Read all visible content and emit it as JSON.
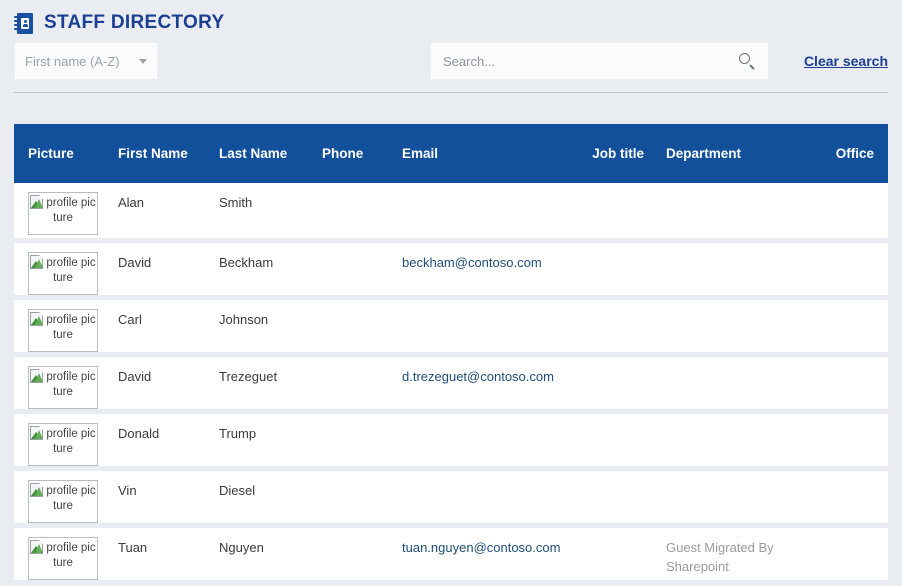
{
  "header": {
    "title": "STAFF DIRECTORY",
    "icon": "address-book-icon"
  },
  "toolbar": {
    "sort": {
      "selected": "First name (A-Z)",
      "icon": "chevron-down-icon"
    },
    "search": {
      "value": "",
      "placeholder": "Search...",
      "icon": "search-icon"
    },
    "clear_search_label": "Clear search"
  },
  "table": {
    "columns": [
      {
        "key": "picture",
        "label": "Picture",
        "align": "left"
      },
      {
        "key": "first_name",
        "label": "First Name",
        "align": "left"
      },
      {
        "key": "last_name",
        "label": "Last Name",
        "align": "left"
      },
      {
        "key": "phone",
        "label": "Phone",
        "align": "left"
      },
      {
        "key": "email",
        "label": "Email",
        "align": "left"
      },
      {
        "key": "job_title",
        "label": "Job title",
        "align": "right"
      },
      {
        "key": "department",
        "label": "Department",
        "align": "left"
      },
      {
        "key": "office",
        "label": "Office",
        "align": "right"
      }
    ],
    "picture_alt": "profile picture",
    "rows": [
      {
        "picture_alt": "profile picture",
        "first_name": "Alan",
        "last_name": "Smith",
        "phone": "",
        "email": "",
        "job_title": "",
        "department": "",
        "office": ""
      },
      {
        "picture_alt": "profile picture",
        "first_name": "David",
        "last_name": "Beckham",
        "phone": "",
        "email": "beckham@contoso.com",
        "job_title": "",
        "department": "",
        "office": ""
      },
      {
        "picture_alt": "profile picture",
        "first_name": "Carl",
        "last_name": "Johnson",
        "phone": "",
        "email": "",
        "job_title": "",
        "department": "",
        "office": ""
      },
      {
        "picture_alt": "profile picture",
        "first_name": "David",
        "last_name": "Trezeguet",
        "phone": "",
        "email": "d.trezeguet@contoso.com",
        "job_title": "",
        "department": "",
        "office": ""
      },
      {
        "picture_alt": "profile picture",
        "first_name": "Donald",
        "last_name": "Trump",
        "phone": "",
        "email": "",
        "job_title": "",
        "department": "",
        "office": ""
      },
      {
        "picture_alt": "profile picture",
        "first_name": "Vin",
        "last_name": "Diesel",
        "phone": "",
        "email": "",
        "job_title": "",
        "department": "",
        "office": ""
      },
      {
        "picture_alt": "profile picture",
        "first_name": "Tuan",
        "last_name": "Nguyen",
        "phone": "",
        "email": "tuan.nguyen@contoso.com",
        "job_title": "",
        "department": "Guest Migrated By Sharepoint",
        "office": ""
      }
    ]
  },
  "colors": {
    "page_background": "#e9edf1",
    "table_header": "#12509c",
    "title": "#1c3f94",
    "link": "#1f4e79",
    "muted_text": "#9b9b9b"
  }
}
